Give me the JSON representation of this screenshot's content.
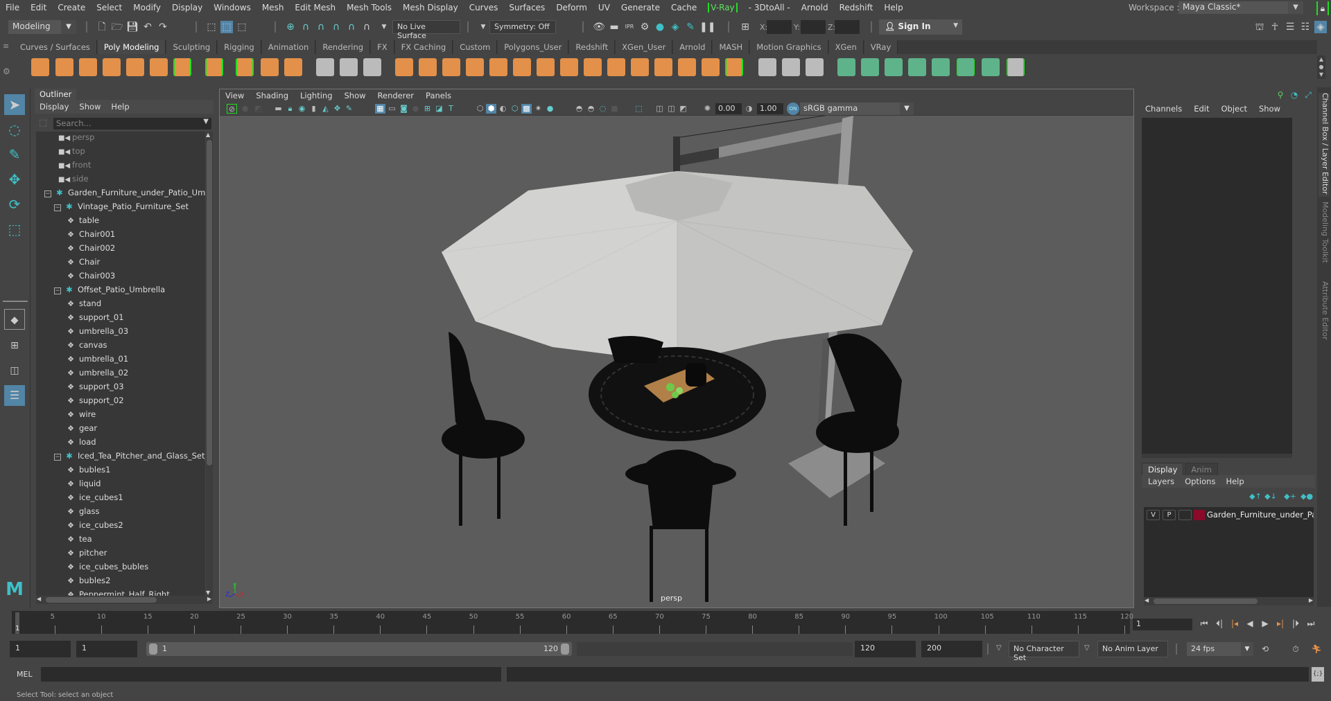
{
  "menubar": {
    "items": [
      "File",
      "Edit",
      "Create",
      "Select",
      "Modify",
      "Display",
      "Windows",
      "Mesh",
      "Edit Mesh",
      "Mesh Tools",
      "Mesh Display",
      "Curves",
      "Surfaces",
      "Deform",
      "UV",
      "Generate",
      "Cache",
      "V-Ray",
      "- 3DtoAll -",
      "Arnold",
      "Redshift",
      "Help"
    ],
    "workspace_label": "Workspace :",
    "workspace_value": "Maya Classic*"
  },
  "statusline": {
    "mode": "Modeling",
    "live_surface": "No Live Surface",
    "symmetry": "Symmetry: Off",
    "x_label": "X:",
    "y_label": "Y:",
    "z_label": "Z:",
    "sign_in": "Sign In"
  },
  "shelf": {
    "tabs": [
      "Curves / Surfaces",
      "Poly Modeling",
      "Sculpting",
      "Rigging",
      "Animation",
      "Rendering",
      "FX",
      "FX Caching",
      "Custom",
      "Polygons_User",
      "Redshift",
      "XGen_User",
      "Arnold",
      "MASH",
      "Motion Graphics",
      "XGen",
      "VRay"
    ],
    "active_tab": "Poly Modeling"
  },
  "outliner": {
    "title": "Outliner",
    "menu": [
      "Display",
      "Show",
      "Help"
    ],
    "search_placeholder": "Search...",
    "items": [
      {
        "label": "persp",
        "type": "camera",
        "depth": 0
      },
      {
        "label": "top",
        "type": "camera",
        "depth": 0
      },
      {
        "label": "front",
        "type": "camera",
        "depth": 0
      },
      {
        "label": "side",
        "type": "camera",
        "depth": 0
      },
      {
        "label": "Garden_Furniture_under_Patio_Umbr",
        "type": "group",
        "depth": 0
      },
      {
        "label": "Vintage_Patio_Furniture_Set",
        "type": "group",
        "depth": 1
      },
      {
        "label": "table",
        "type": "mesh",
        "depth": 2
      },
      {
        "label": "Chair001",
        "type": "mesh",
        "depth": 2
      },
      {
        "label": "Chair002",
        "type": "mesh",
        "depth": 2
      },
      {
        "label": "Chair",
        "type": "mesh",
        "depth": 2
      },
      {
        "label": "Chair003",
        "type": "mesh",
        "depth": 2
      },
      {
        "label": "Offset_Patio_Umbrella",
        "type": "group",
        "depth": 1
      },
      {
        "label": "stand",
        "type": "mesh",
        "depth": 2
      },
      {
        "label": "support_01",
        "type": "mesh",
        "depth": 2
      },
      {
        "label": "umbrella_03",
        "type": "mesh",
        "depth": 2
      },
      {
        "label": "canvas",
        "type": "mesh",
        "depth": 2
      },
      {
        "label": "umbrella_01",
        "type": "mesh",
        "depth": 2
      },
      {
        "label": "umbrella_02",
        "type": "mesh",
        "depth": 2
      },
      {
        "label": "support_03",
        "type": "mesh",
        "depth": 2
      },
      {
        "label": "support_02",
        "type": "mesh",
        "depth": 2
      },
      {
        "label": "wire",
        "type": "mesh",
        "depth": 2
      },
      {
        "label": "gear",
        "type": "mesh",
        "depth": 2
      },
      {
        "label": "load",
        "type": "mesh",
        "depth": 2
      },
      {
        "label": "Iced_Tea_Pitcher_and_Glass_Set_wi",
        "type": "group",
        "depth": 1
      },
      {
        "label": "bubles1",
        "type": "mesh",
        "depth": 2
      },
      {
        "label": "liquid",
        "type": "mesh",
        "depth": 2
      },
      {
        "label": "ice_cubes1",
        "type": "mesh",
        "depth": 2
      },
      {
        "label": "glass",
        "type": "mesh",
        "depth": 2
      },
      {
        "label": "ice_cubes2",
        "type": "mesh",
        "depth": 2
      },
      {
        "label": "tea",
        "type": "mesh",
        "depth": 2
      },
      {
        "label": "pitcher",
        "type": "mesh",
        "depth": 2
      },
      {
        "label": "ice_cubes_bubles",
        "type": "mesh",
        "depth": 2
      },
      {
        "label": "bubles2",
        "type": "mesh",
        "depth": 2
      },
      {
        "label": "Peppermint_Half_Right",
        "type": "mesh",
        "depth": 2
      }
    ]
  },
  "viewport": {
    "menu": [
      "View",
      "Shading",
      "Lighting",
      "Show",
      "Renderer",
      "Panels"
    ],
    "exposure": "0.00",
    "gamma": "1.00",
    "color_space_toggle": "ON",
    "color_space": "sRGB gamma",
    "camera_label": "persp",
    "axis": {
      "x": "X",
      "y": "y",
      "z": "Z"
    }
  },
  "channel_box": {
    "menu": [
      "Channels",
      "Edit",
      "Object",
      "Show"
    ]
  },
  "layer_editor": {
    "tabs": [
      "Display",
      "Anim"
    ],
    "active_tab": "Display",
    "menu": [
      "Layers",
      "Options",
      "Help"
    ],
    "layers": [
      {
        "v": "V",
        "p": "P",
        "name": "Garden_Furniture_under_Patio",
        "color": "#8a0a2a"
      }
    ]
  },
  "side_tabs": [
    "Channel Box / Layer Editor",
    "Modeling Toolkit",
    "Attribute Editor"
  ],
  "timeslider": {
    "ticks": [
      5,
      10,
      15,
      20,
      25,
      30,
      35,
      40,
      45,
      50,
      55,
      60,
      65,
      70,
      75,
      80,
      85,
      90,
      95,
      100,
      105,
      110,
      115,
      120
    ],
    "current_frame": "1",
    "current_frame_field": "1",
    "range_start": 1,
    "range_end": 120
  },
  "range": {
    "start_field": "1",
    "playback_start": "1",
    "slider_min": "1",
    "slider_max": "120",
    "playback_end": "120",
    "end_field": "200",
    "character_set": "No Character Set",
    "anim_layer": "No Anim Layer",
    "fps": "24 fps"
  },
  "commandline": {
    "mode": "MEL",
    "script_editor_icon": "{;}"
  },
  "helpline": "Select Tool: select an object",
  "colors": {
    "accent_blue": "#5285a6",
    "shelf_orange": "#e3904a",
    "shelf_green": "#5fb38a",
    "highlight_green": "#22dd22",
    "group_icon_cyan": "#3fc0c8"
  }
}
